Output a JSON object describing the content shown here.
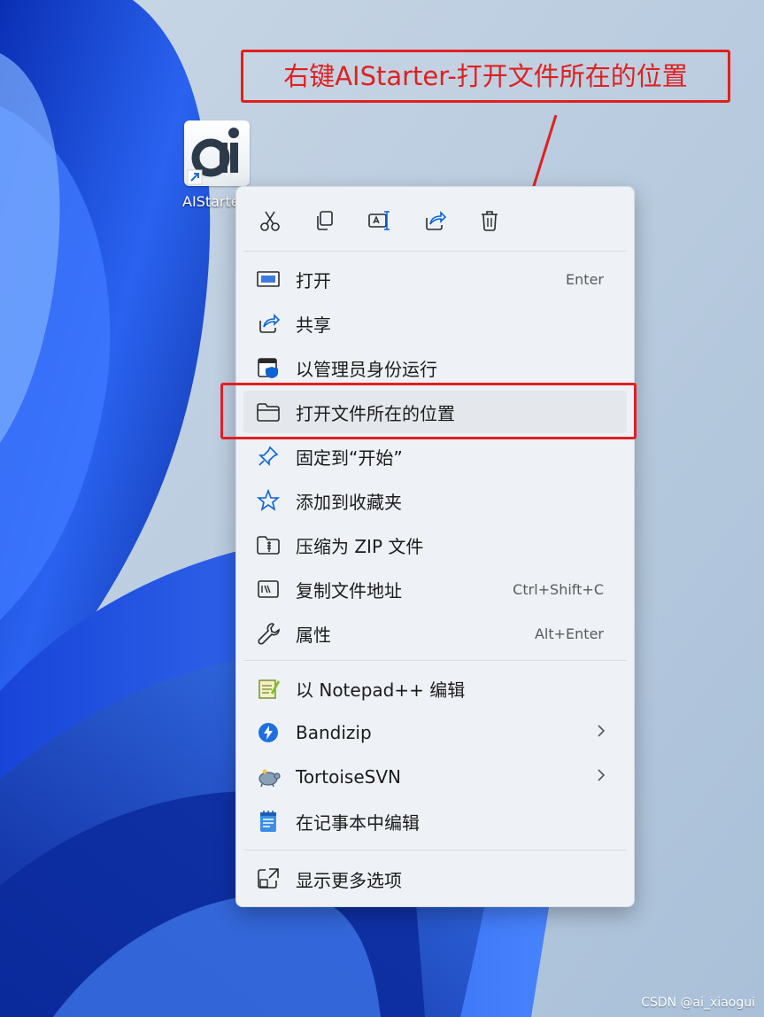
{
  "desktop_icon": {
    "label": "AIStarter"
  },
  "annotation": {
    "text": "右键AIStarter-打开文件所在的位置"
  },
  "toolbar": {
    "items": [
      {
        "icon": "cut-icon"
      },
      {
        "icon": "copy-icon"
      },
      {
        "icon": "rename-icon"
      },
      {
        "icon": "share-icon"
      },
      {
        "icon": "delete-icon"
      }
    ]
  },
  "menu": {
    "items": [
      {
        "label": "打开",
        "shortcut": "Enter",
        "icon": "open-window-icon"
      },
      {
        "label": "共享",
        "icon": "share-icon"
      },
      {
        "label": "以管理员身份运行",
        "icon": "admin-shield-icon"
      },
      {
        "label": "打开文件所在的位置",
        "icon": "folder-icon",
        "highlighted": true
      },
      {
        "label": "固定到“开始”",
        "icon": "pin-icon"
      },
      {
        "label": "添加到收藏夹",
        "icon": "star-icon"
      },
      {
        "label": "压缩为 ZIP 文件",
        "icon": "zip-folder-icon"
      },
      {
        "label": "复制文件地址",
        "shortcut": "Ctrl+Shift+C",
        "icon": "copy-path-icon"
      },
      {
        "label": "属性",
        "shortcut": "Alt+Enter",
        "icon": "wrench-icon"
      },
      {
        "label": "以 Notepad++ 编辑",
        "icon": "notepadpp-icon"
      },
      {
        "label": "Bandizip",
        "icon": "bandizip-icon",
        "submenu": true
      },
      {
        "label": "TortoiseSVN",
        "icon": "tortoise-icon",
        "submenu": true
      },
      {
        "label": "在记事本中编辑",
        "icon": "notepad-icon"
      },
      {
        "label": "显示更多选项",
        "icon": "more-options-icon"
      }
    ]
  },
  "watermark": {
    "text": "CSDN @ai_xiaogui"
  },
  "colors": {
    "annotation_red": "#e02020",
    "wallpaper_blue": "#1a4fd6",
    "accent_blue": "#0b63d4"
  }
}
